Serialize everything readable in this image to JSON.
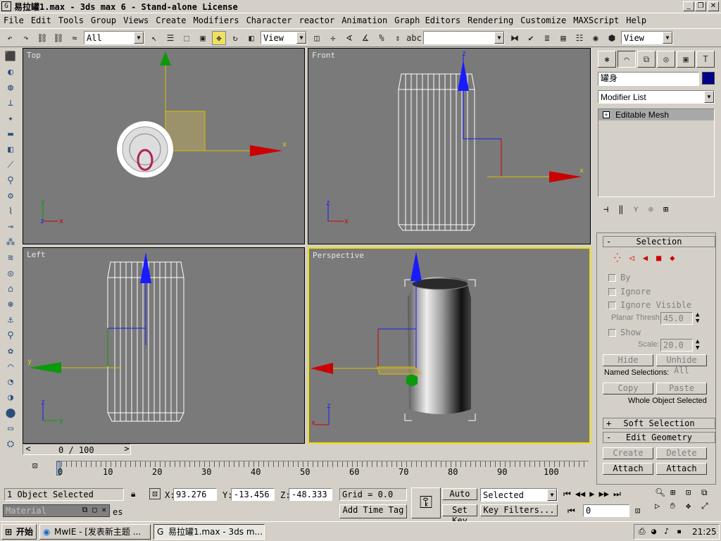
{
  "window": {
    "title": "易拉罐1.max - 3ds max 6 - Stand-alone License"
  },
  "menu": [
    "File",
    "Edit",
    "Tools",
    "Group",
    "Views",
    "Create",
    "Modifiers",
    "Character",
    "reactor",
    "Animation",
    "Graph Editors",
    "Rendering",
    "Customize",
    "MAXScript",
    "Help"
  ],
  "toolbar": {
    "filter": "All",
    "ref_coord": "View",
    "named_sel": "",
    "render_view": "View"
  },
  "viewports": {
    "top": "Top",
    "front": "Front",
    "left": "Left",
    "perspective": "Perspective"
  },
  "axes": {
    "x": "x",
    "y": "y",
    "z": "z"
  },
  "panel": {
    "object_name": "罐身",
    "modifier_list": "Modifier List",
    "stack_item": "Editable Mesh",
    "selection": "Selection",
    "by": "By",
    "ignore": "Ignore",
    "ignore_visible": "Ignore Visible",
    "planar_thresh_label": "Planar Thresh:",
    "planar_thresh": "45.0",
    "show": "Show",
    "scale_label": "Scale:",
    "scale": "20.0",
    "hide": "Hide",
    "unhide_all": "Unhide All",
    "named_selections": "Named Selections:",
    "copy": "Copy",
    "paste": "Paste",
    "whole_object": "Whole Object Selected",
    "soft_selection": "Soft Selection",
    "edit_geometry": "Edit Geometry",
    "create": "Create",
    "delete": "Delete",
    "attach": "Attach",
    "attach_list": "Attach List"
  },
  "timeline": {
    "frame": "0 / 100",
    "ticks": [
      "0",
      "10",
      "20",
      "30",
      "40",
      "50",
      "60",
      "70",
      "80",
      "90",
      "100"
    ]
  },
  "status": {
    "selected": "1 Object Selected",
    "x_label": "X:",
    "x": "93.276",
    "y_label": "Y:",
    "y": "-13.456",
    "z_label": "Z:",
    "z": "-48.333",
    "grid": "Grid = 0.0",
    "add_time_tag": "Add Time Tag",
    "auto_key": "Auto Key",
    "set_key": "Set Key",
    "key_mode": "Selected",
    "key_filters": "Key Filters...",
    "frame_field": "0",
    "material_window": "Material",
    "status_tail": "es"
  },
  "taskbar": {
    "start": "开始",
    "task1": "MwIE - [发表新主题 ...",
    "task2": "易拉罐1.max - 3ds m...",
    "clock": "21:25"
  }
}
